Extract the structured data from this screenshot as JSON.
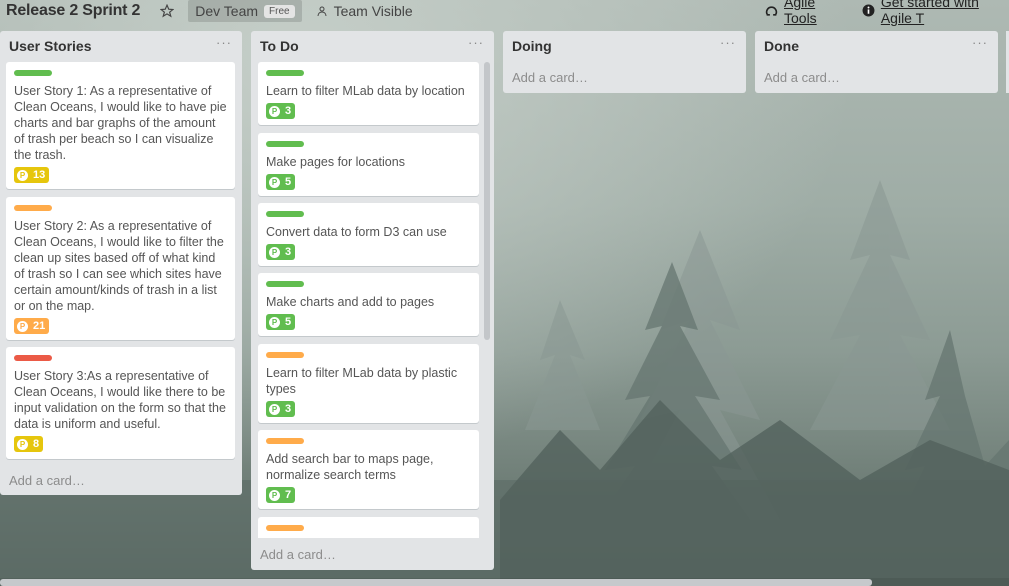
{
  "header": {
    "board_title": "Release 2 Sprint 2",
    "team_name": "Dev Team",
    "team_badge": "Free",
    "visibility": "Team Visible",
    "agile_tools": "Agile Tools",
    "get_started": "Get started with Agile T"
  },
  "colors": {
    "green": "#61bd4f",
    "orange": "#ffab4a",
    "red": "#eb5a46",
    "yellow": "#f2d600"
  },
  "lists": [
    {
      "title": "User Stories",
      "menu": "···",
      "add_card": "Add a card…",
      "cards": [
        {
          "label_color": "green",
          "text": "User Story 1: As a representative of Clean Oceans, I would like to have pie charts and bar graphs of the amount of trash per beach so I can visualize the trash.",
          "points": "13",
          "badge_color": "yellow",
          "badge_icon": "p-icon"
        },
        {
          "label_color": "orange",
          "text": "User Story 2: As a representative of Clean Oceans, I would like to filter the clean up sites based off of what kind of trash so I can see which sites have certain amount/kinds of trash in a list or on the map.",
          "points": "21",
          "badge_color": "orange",
          "badge_icon": "p-icon"
        },
        {
          "label_color": "red",
          "text": "User Story 3:As a representative of Clean Oceans, I would like there to be input validation on the form so that the data is uniform and useful.",
          "points": "8",
          "badge_color": "yellow",
          "badge_icon": "p-icon"
        }
      ]
    },
    {
      "title": "To Do",
      "menu": "···",
      "add_card": "Add a card…",
      "cards": [
        {
          "label_color": "green",
          "text": "Learn to filter MLab data by location",
          "points": "3",
          "badge_color": "green"
        },
        {
          "label_color": "green",
          "text": "Make pages for locations",
          "points": "5",
          "badge_color": "green"
        },
        {
          "label_color": "green",
          "text": "Convert data to form D3 can use",
          "points": "3",
          "badge_color": "green"
        },
        {
          "label_color": "green",
          "text": "Make charts and add to pages",
          "points": "5",
          "badge_color": "green"
        },
        {
          "label_color": "orange",
          "text": "Learn to filter MLab data by plastic types",
          "points": "3",
          "badge_color": "green"
        },
        {
          "label_color": "orange",
          "text": "Add search bar to maps page, normalize search terms",
          "points": "7",
          "badge_color": "green"
        },
        {
          "label_color": "orange",
          "text": "",
          "points": "",
          "badge_color": "green"
        }
      ]
    },
    {
      "title": "Doing",
      "menu": "···",
      "add_card": "Add a card…",
      "cards": []
    },
    {
      "title": "Done",
      "menu": "···",
      "add_card": "Add a card…",
      "cards": []
    }
  ]
}
